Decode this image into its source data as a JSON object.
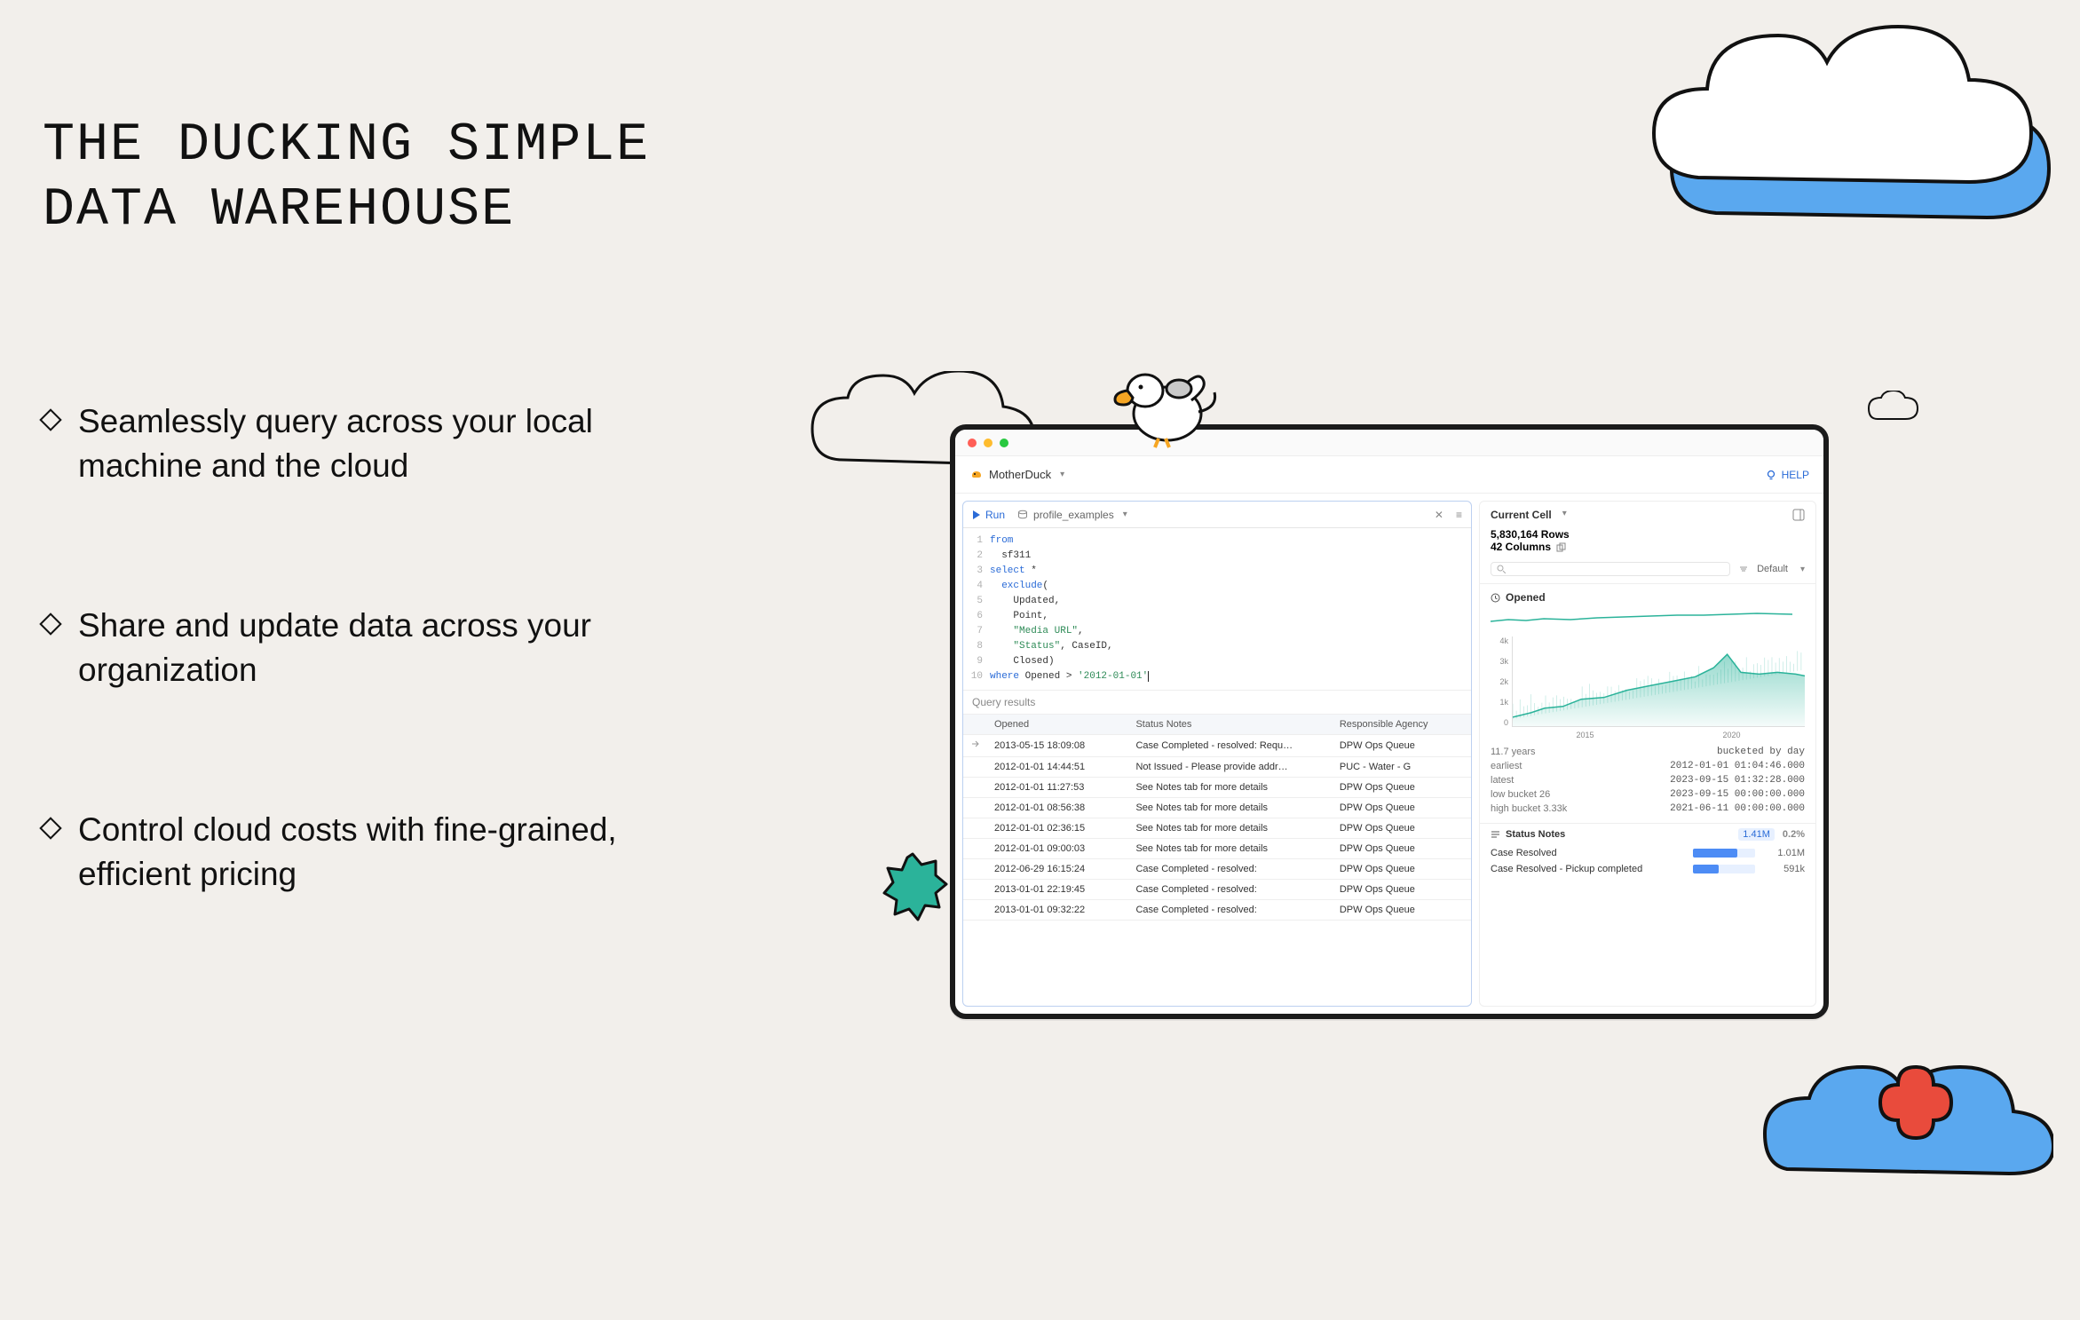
{
  "hero": {
    "title_line1": "THE DUCKING SIMPLE",
    "title_line2": "DATA WAREHOUSE"
  },
  "bullets": [
    "Seamlessly query across your local machine and the cloud",
    "Share and update data across your organization",
    "Control cloud costs with fine-grained, efficient pricing"
  ],
  "app": {
    "brand": "MotherDuck",
    "help": "HELP",
    "toolbar": {
      "run": "Run",
      "tab_name": "profile_examples"
    },
    "code": [
      {
        "n": 1,
        "indent": 0,
        "tokens": [
          [
            "kw",
            "from"
          ]
        ]
      },
      {
        "n": 2,
        "indent": 1,
        "tokens": [
          [
            "",
            "sf311"
          ]
        ]
      },
      {
        "n": 3,
        "indent": 0,
        "tokens": [
          [
            "kw",
            "select "
          ],
          [
            "",
            "*"
          ]
        ]
      },
      {
        "n": 4,
        "indent": 1,
        "tokens": [
          [
            "kw",
            "exclude"
          ],
          [
            "",
            "("
          ]
        ]
      },
      {
        "n": 5,
        "indent": 2,
        "tokens": [
          [
            "",
            "Updated,"
          ]
        ]
      },
      {
        "n": 6,
        "indent": 2,
        "tokens": [
          [
            "",
            "Point,"
          ]
        ]
      },
      {
        "n": 7,
        "indent": 2,
        "tokens": [
          [
            "str",
            "\"Media URL\""
          ],
          [
            "",
            ","
          ]
        ]
      },
      {
        "n": 8,
        "indent": 2,
        "tokens": [
          [
            "str",
            "\"Status\""
          ],
          [
            "",
            ", CaseID,"
          ]
        ]
      },
      {
        "n": 9,
        "indent": 2,
        "tokens": [
          [
            "",
            "Closed)"
          ]
        ]
      },
      {
        "n": 10,
        "indent": 0,
        "tokens": [
          [
            "kw",
            "where "
          ],
          [
            "",
            "Opened > "
          ],
          [
            "str",
            "'2012-01-01'"
          ]
        ]
      }
    ],
    "results_label": "Query results",
    "results": {
      "columns": [
        "",
        "Opened",
        "Status Notes",
        "Responsible Agency"
      ],
      "rows": [
        [
          "2013-05-15 18:09:08",
          "Case Completed - resolved: Requ…",
          "DPW Ops Queue"
        ],
        [
          "2012-01-01 14:44:51",
          "Not Issued - Please provide addr…",
          "PUC - Water - G"
        ],
        [
          "2012-01-01 11:27:53",
          "See Notes tab for more details",
          "DPW Ops Queue"
        ],
        [
          "2012-01-01 08:56:38",
          "See Notes tab for more details",
          "DPW Ops Queue"
        ],
        [
          "2012-01-01 02:36:15",
          "See Notes tab for more details",
          "DPW Ops Queue"
        ],
        [
          "2012-01-01 09:00:03",
          "See Notes tab for more details",
          "DPW Ops Queue"
        ],
        [
          "2012-06-29 16:15:24",
          "Case Completed - resolved:",
          "DPW Ops Queue"
        ],
        [
          "2013-01-01 22:19:45",
          "Case Completed - resolved:",
          "DPW Ops Queue"
        ],
        [
          "2013-01-01 09:32:22",
          "Case Completed - resolved:",
          "DPW Ops Queue"
        ]
      ]
    },
    "inspector": {
      "title": "Current Cell",
      "rows_count": "5,830,164 Rows",
      "cols_count": "42 Columns",
      "sort_label": "Default",
      "col1": {
        "name": "Opened",
        "span_label": "11.7 years",
        "bucket_label": "bucketed by day",
        "kv": [
          {
            "k": "earliest",
            "v": "2012-01-01  01:04:46.000"
          },
          {
            "k": "latest",
            "v": "2023-09-15  01:32:28.000"
          },
          {
            "k": "low bucket   26",
            "v": "2023-09-15  00:00:00.000"
          },
          {
            "k": "high bucket  3.33k",
            "v": "2021-06-11  00:00:00.000"
          }
        ],
        "y_ticks": [
          "4k",
          "3k",
          "2k",
          "1k",
          "0"
        ],
        "x_ticks": [
          "2015",
          "2020"
        ]
      },
      "col2": {
        "name": "Status Notes",
        "total": "1.41M",
        "pct": "0.2%",
        "bars": [
          {
            "label": "Case Resolved",
            "n": "1.01M",
            "w": 72
          },
          {
            "label": "Case Resolved - Pickup completed",
            "n": "591k",
            "w": 42
          }
        ]
      }
    }
  },
  "chart_data": {
    "type": "area",
    "title": "Opened",
    "xlabel": "",
    "ylabel": "",
    "x_ticks": [
      "2015",
      "2020"
    ],
    "y_ticks": [
      0,
      1000,
      2000,
      3000,
      4000
    ],
    "ylim": [
      0,
      4000
    ],
    "note": "bucketed by day",
    "series": [
      {
        "name": "count",
        "x": [
          "2012",
          "2013",
          "2014",
          "2015",
          "2016",
          "2017",
          "2018",
          "2019",
          "2020",
          "2021",
          "2022",
          "2023"
        ],
        "values": [
          400,
          600,
          700,
          900,
          1100,
          1300,
          1500,
          1700,
          1900,
          2400,
          2200,
          2100
        ]
      }
    ],
    "high_bucket": {
      "date": "2021-06-11",
      "value": 3330
    },
    "low_bucket": {
      "date": "2023-09-15",
      "value": 26
    }
  }
}
